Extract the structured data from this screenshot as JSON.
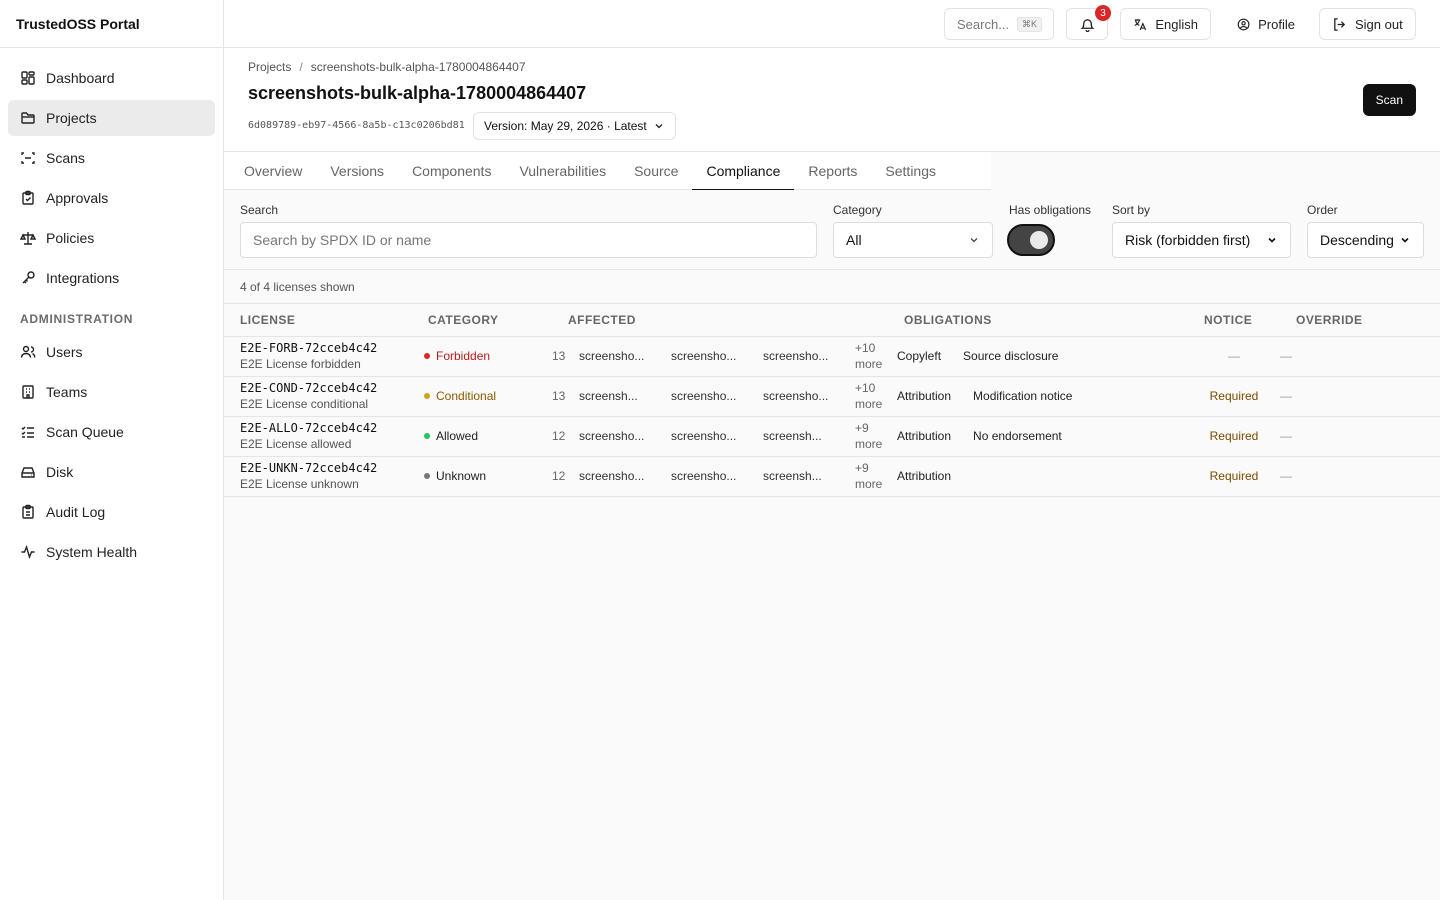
{
  "app": {
    "title": "TrustedOSS Portal"
  },
  "sidebar": {
    "items": [
      {
        "label": "Dashboard",
        "icon": "dashboard-icon"
      },
      {
        "label": "Projects",
        "icon": "folder-icon",
        "active": true
      },
      {
        "label": "Scans",
        "icon": "scan-icon"
      },
      {
        "label": "Approvals",
        "icon": "clipboard-check-icon"
      },
      {
        "label": "Policies",
        "icon": "scale-icon"
      },
      {
        "label": "Integrations",
        "icon": "key-icon"
      }
    ],
    "admin_heading": "ADMINISTRATION",
    "admin_items": [
      {
        "label": "Users",
        "icon": "users-icon"
      },
      {
        "label": "Teams",
        "icon": "building-icon"
      },
      {
        "label": "Scan Queue",
        "icon": "list-check-icon"
      },
      {
        "label": "Disk",
        "icon": "disk-icon"
      },
      {
        "label": "Audit Log",
        "icon": "clipboard-list-icon"
      },
      {
        "label": "System Health",
        "icon": "activity-icon"
      }
    ]
  },
  "header": {
    "search_label": "Search...",
    "search_shortcut": "⌘K",
    "notification_count": "3",
    "language": "English",
    "profile": "Profile",
    "sign_out": "Sign out"
  },
  "page": {
    "breadcrumb": [
      "Projects",
      "screenshots-bulk-alpha-1780004864407"
    ],
    "title": "screenshots-bulk-alpha-1780004864407",
    "uuid": "6d089789-eb97-4566-8a5b-c13c0206bd81",
    "version": "Version: May 29, 2026 · Latest",
    "scan_label": "Scan"
  },
  "tabs": [
    "Overview",
    "Versions",
    "Components",
    "Vulnerabilities",
    "Source",
    "Compliance",
    "Reports",
    "Settings"
  ],
  "active_tab": "Compliance",
  "filters": {
    "search_label": "Search",
    "search_placeholder": "Search by SPDX ID or name",
    "category_label": "Category",
    "category_value": "All",
    "has_obligations_label": "Has obligations",
    "has_obligations_on": true,
    "sort_label": "Sort by",
    "sort_value": "Risk (forbidden first)",
    "order_label": "Order",
    "order_value": "Descending"
  },
  "count_text": "4 of 4 licenses shown",
  "table": {
    "columns": [
      "LICENSE",
      "CATEGORY",
      "AFFECTED",
      "OBLIGATIONS",
      "NOTICE",
      "OVERRIDE"
    ],
    "rows": [
      {
        "id": "E2E-FORB-72cceb4c42",
        "name": "E2E License forbidden",
        "category": "Forbidden",
        "category_color": "#dc2626",
        "category_text_color": "#b91c1c",
        "affected_count": "13",
        "affected": [
          "screensho...",
          "screensho...",
          "screensho..."
        ],
        "more_count": "+10",
        "more_word": "more",
        "obligations": [
          "Copyleft",
          "Source disclosure"
        ],
        "notice": "—",
        "override": "—"
      },
      {
        "id": "E2E-COND-72cceb4c42",
        "name": "E2E License conditional",
        "category": "Conditional",
        "category_color": "#d4a017",
        "category_text_color": "#8a5a00",
        "affected_count": "13",
        "affected": [
          "screensh...",
          "screensho...",
          "screensho..."
        ],
        "more_count": "+10",
        "more_word": "more",
        "obligations": [
          "Attribution",
          "Modification notice"
        ],
        "notice": "Required",
        "override": "—"
      },
      {
        "id": "E2E-ALLO-72cceb4c42",
        "name": "E2E License allowed",
        "category": "Allowed",
        "category_color": "#22c55e",
        "category_text_color": "#222222",
        "affected_count": "12",
        "affected": [
          "screensho...",
          "screensho...",
          "screensh..."
        ],
        "more_count": "+9",
        "more_word": "more",
        "obligations": [
          "Attribution",
          "No endorsement"
        ],
        "notice": "Required",
        "override": "—"
      },
      {
        "id": "E2E-UNKN-72cceb4c42",
        "name": "E2E License unknown",
        "category": "Unknown",
        "category_color": "#777777",
        "category_text_color": "#222222",
        "affected_count": "12",
        "affected": [
          "screensho...",
          "screensho...",
          "screensh..."
        ],
        "more_count": "+9",
        "more_word": "more",
        "obligations": [
          "Attribution"
        ],
        "notice": "Required",
        "override": "—"
      }
    ]
  }
}
